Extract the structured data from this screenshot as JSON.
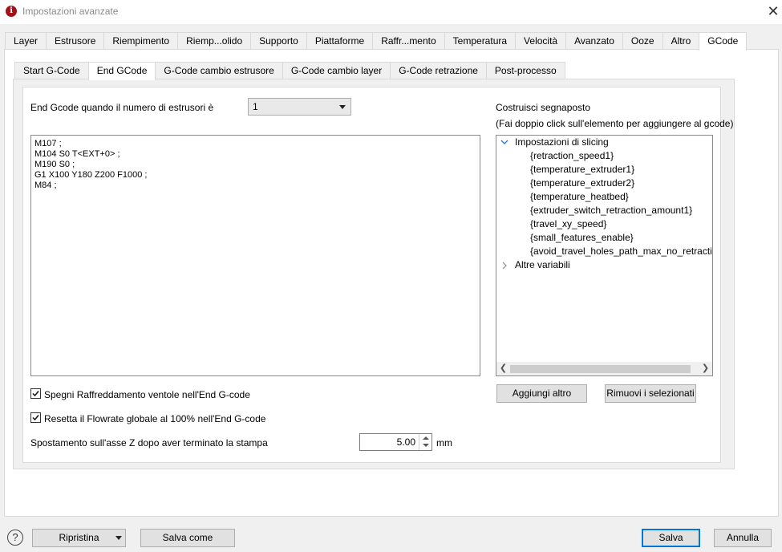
{
  "window": {
    "title": "Impostazioni avanzate"
  },
  "main_tabs": [
    {
      "label": "Layer"
    },
    {
      "label": "Estrusore"
    },
    {
      "label": "Riempimento"
    },
    {
      "label": "Riemp...olido"
    },
    {
      "label": "Supporto"
    },
    {
      "label": "Piattaforme"
    },
    {
      "label": "Raffr...mento"
    },
    {
      "label": "Temperatura"
    },
    {
      "label": "Velocità"
    },
    {
      "label": "Avanzato"
    },
    {
      "label": "Ooze"
    },
    {
      "label": "Altro"
    },
    {
      "label": "GCode"
    }
  ],
  "main_tab_active": "GCode",
  "sub_tabs": [
    {
      "label": "Start G-Code"
    },
    {
      "label": "End GCode"
    },
    {
      "label": "G-Code cambio estrusore"
    },
    {
      "label": "G-Code cambio layer"
    },
    {
      "label": "G-Code retrazione"
    },
    {
      "label": "Post-processo"
    }
  ],
  "sub_tab_active": "End GCode",
  "extruders": {
    "label": "End Gcode quando il numero di estrusori è",
    "value": "1"
  },
  "editor": {
    "lines": [
      "M107 ;",
      "M104 S0 T<EXT+0> ;",
      "M190 S0 ;",
      "G1 X100 Y180 Z200 F1000 ;",
      "M84 ;"
    ]
  },
  "placeholders": {
    "title": "Costruisci segnaposto",
    "hint": "(Fai doppio click sull'elemento per aggiungere al gcode)",
    "group1": "Impostazioni di slicing",
    "items": [
      "{retraction_speed1}",
      "{temperature_extruder1}",
      "{temperature_extruder2}",
      "{temperature_heatbed}",
      "{extruder_switch_retraction_amount1}",
      "{travel_xy_speed}",
      "{small_features_enable}",
      "{avoid_travel_holes_path_max_no_retractio"
    ],
    "group2": "Altre variabili",
    "add_button": "Aggiungi altro",
    "remove_button": "Rimuovi i selezionati"
  },
  "options": {
    "fan_off_label": "Spegni Raffreddamento ventole nell'End G-code",
    "fan_off_checked": true,
    "flowrate_label": "Resetta il Flowrate globale al 100% nell'End G-code",
    "flowrate_checked": true,
    "z_move_label": "Spostamento sull'asse Z dopo aver terminato la stampa",
    "z_move_value": "5.00",
    "z_move_unit": "mm"
  },
  "footer": {
    "help": "?",
    "reset_button": "Ripristina",
    "save_as_button": "Salva come",
    "save_button": "Salva",
    "cancel_button": "Annulla"
  }
}
